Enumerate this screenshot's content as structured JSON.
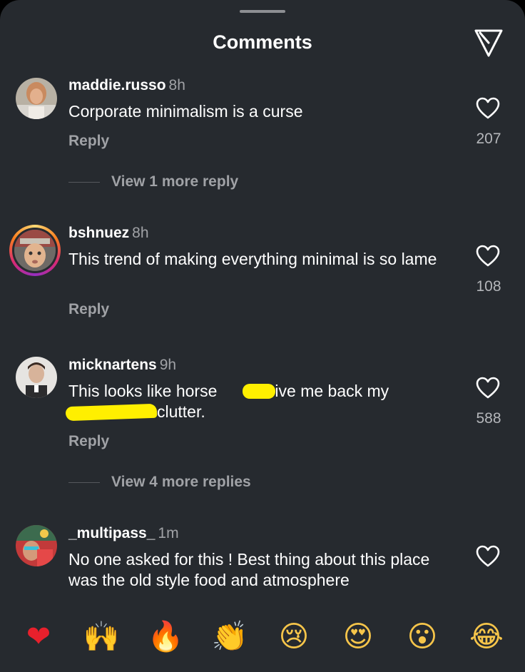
{
  "header": {
    "title": "Comments",
    "share_icon": "send-icon"
  },
  "comments": [
    {
      "username": "maddie.russo",
      "time": "8h",
      "text": "Corporate minimalism is a curse",
      "reply_label": "Reply",
      "likes": "207",
      "view_replies": "View 1 more reply"
    },
    {
      "username": "bshnuez",
      "time": "8h",
      "text": "This trend of making everything minimal is so lame",
      "reply_label": "Reply",
      "likes": "108",
      "has_story_ring": true
    },
    {
      "username": "micknartens",
      "time": "9h",
      "text_part1": "This looks like horse ",
      "text_part2": ". Give me back my",
      "text_part3": "clutter.",
      "reply_label": "Reply",
      "likes": "588",
      "view_replies": "View 4 more replies",
      "redaction_color": "#ffef00"
    },
    {
      "username": "_multipass_",
      "time": "1m",
      "text": "No one asked for this ! Best thing about this place was the old style food and atmosphere"
    }
  ],
  "reactions": [
    "❤",
    "🙌",
    "🔥",
    "👏",
    "😢",
    "😍",
    "😮",
    "😂"
  ],
  "colors": {
    "background": "#262a2f",
    "text": "#ffffff",
    "muted": "#a0a2a6"
  }
}
